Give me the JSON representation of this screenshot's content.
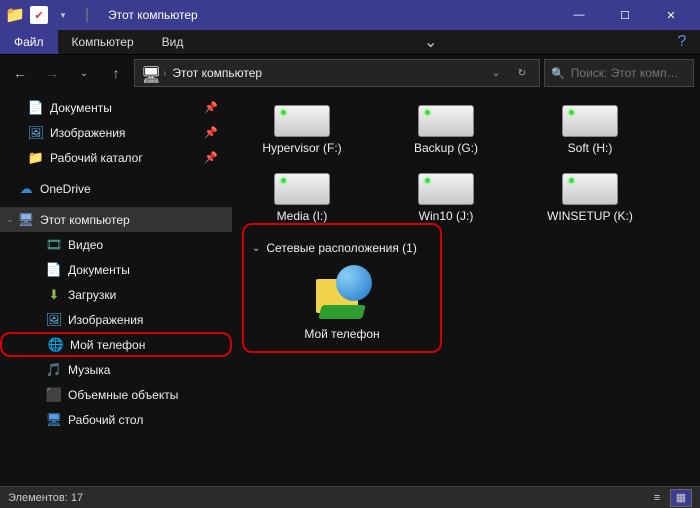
{
  "titlebar": {
    "title": "Этот компьютер"
  },
  "win": {
    "min": "—",
    "max": "☐",
    "close": "✕"
  },
  "ribbon": {
    "file": "Файл",
    "computer": "Компьютер",
    "view": "Вид",
    "help_chev": "⌄",
    "help_q": "?"
  },
  "nav": {
    "back": "←",
    "fwd": "→",
    "recent": "⌄",
    "up": "↑",
    "refresh": "↻",
    "dd": "⌄"
  },
  "address": {
    "sep": "›",
    "crumb": "Этот компьютер"
  },
  "search": {
    "icon": "🔍",
    "placeholder": "Поиск: Этот комп…"
  },
  "sidebar": {
    "quick": [
      {
        "label": "Документы",
        "pin": "📌",
        "icon": "📄"
      },
      {
        "label": "Изображения",
        "pin": "📌",
        "icon": "🖼"
      },
      {
        "label": "Рабочий каталог",
        "pin": "📌",
        "icon": "📁"
      }
    ],
    "onedrive": {
      "label": "OneDrive",
      "icon": "☁"
    },
    "thispc": {
      "label": "Этот компьютер",
      "icon": "🖥"
    },
    "pcitems": [
      {
        "label": "Видео",
        "icon": "🎞"
      },
      {
        "label": "Документы",
        "icon": "📄"
      },
      {
        "label": "Загрузки",
        "icon": "⬇"
      },
      {
        "label": "Изображения",
        "icon": "🖼"
      },
      {
        "label": "Мой телефон",
        "icon": "🌐",
        "hl": true
      },
      {
        "label": "Музыка",
        "icon": "🎵"
      },
      {
        "label": "Объемные объекты",
        "icon": "⬛"
      },
      {
        "label": "Рабочий стол",
        "icon": "🖥"
      }
    ]
  },
  "drives": [
    {
      "label": "Hypervisor (F:)"
    },
    {
      "label": "Backup (G:)"
    },
    {
      "label": "Soft (H:)"
    },
    {
      "label": "Media (I:)"
    },
    {
      "label": "Win10 (J:)"
    },
    {
      "label": "WINSETUP (K:)"
    }
  ],
  "section": {
    "network": "Сетевые расположения (1)"
  },
  "network_item": {
    "label": "Мой телефон"
  },
  "status": {
    "count_label": "Элементов:",
    "count": "17"
  }
}
